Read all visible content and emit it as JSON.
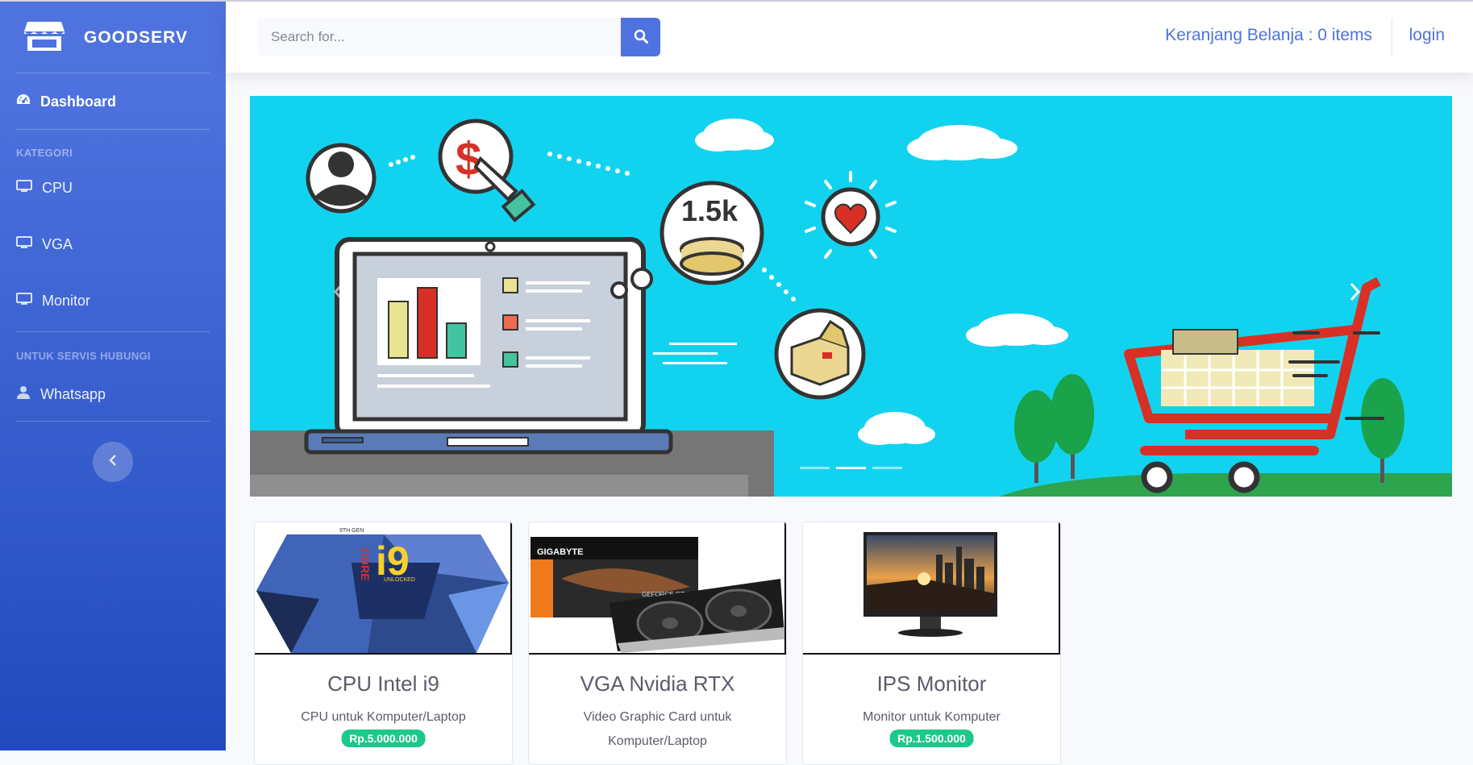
{
  "brand": {
    "name": "GOODSERV",
    "icon": "store-icon"
  },
  "sidebar": {
    "dashboard": {
      "label": "Dashboard",
      "icon": "tachometer-icon"
    },
    "kategori_heading": "KATEGORI",
    "categories": [
      {
        "label": "CPU",
        "icon": "desktop-icon"
      },
      {
        "label": "VGA",
        "icon": "desktop-icon"
      },
      {
        "label": "Monitor",
        "icon": "desktop-icon"
      }
    ],
    "service_heading": "UNTUK SERVIS HUBUNGI",
    "contact": {
      "label": "Whatsapp",
      "icon": "user-icon"
    },
    "toggle_icon": "chevron-left-icon"
  },
  "topbar": {
    "search_placeholder": "Search for...",
    "search_icon": "search-icon",
    "cart_label": "Keranjang Belanja : 0 items",
    "login_label": "login"
  },
  "carousel": {
    "banner_coin_text": "1.5k",
    "banner_dollar_text": "$",
    "slide_count": 3,
    "active_slide": 2
  },
  "products": [
    {
      "title": "CPU Intel i9",
      "description": "CPU untuk Komputer/Laptop",
      "price": "Rp.5.000.000",
      "image_text": "i9",
      "image_subtext": "UNLOCKED",
      "image_side_text": "CORE",
      "image_top_text": "9TH GEN"
    },
    {
      "title": "VGA Nvidia RTX",
      "description": "Video Graphic Card untuk Komputer/Laptop",
      "price": "",
      "image_text": "GIGABYTE",
      "image_subtext": "GEFORCE GTX"
    },
    {
      "title": "IPS Monitor",
      "description": "Monitor untuk Komputer",
      "price": "Rp.1.500.000"
    }
  ],
  "colors": {
    "primary": "#4e73df",
    "success": "#1cc88a",
    "banner_bg": "#12d3ef"
  }
}
